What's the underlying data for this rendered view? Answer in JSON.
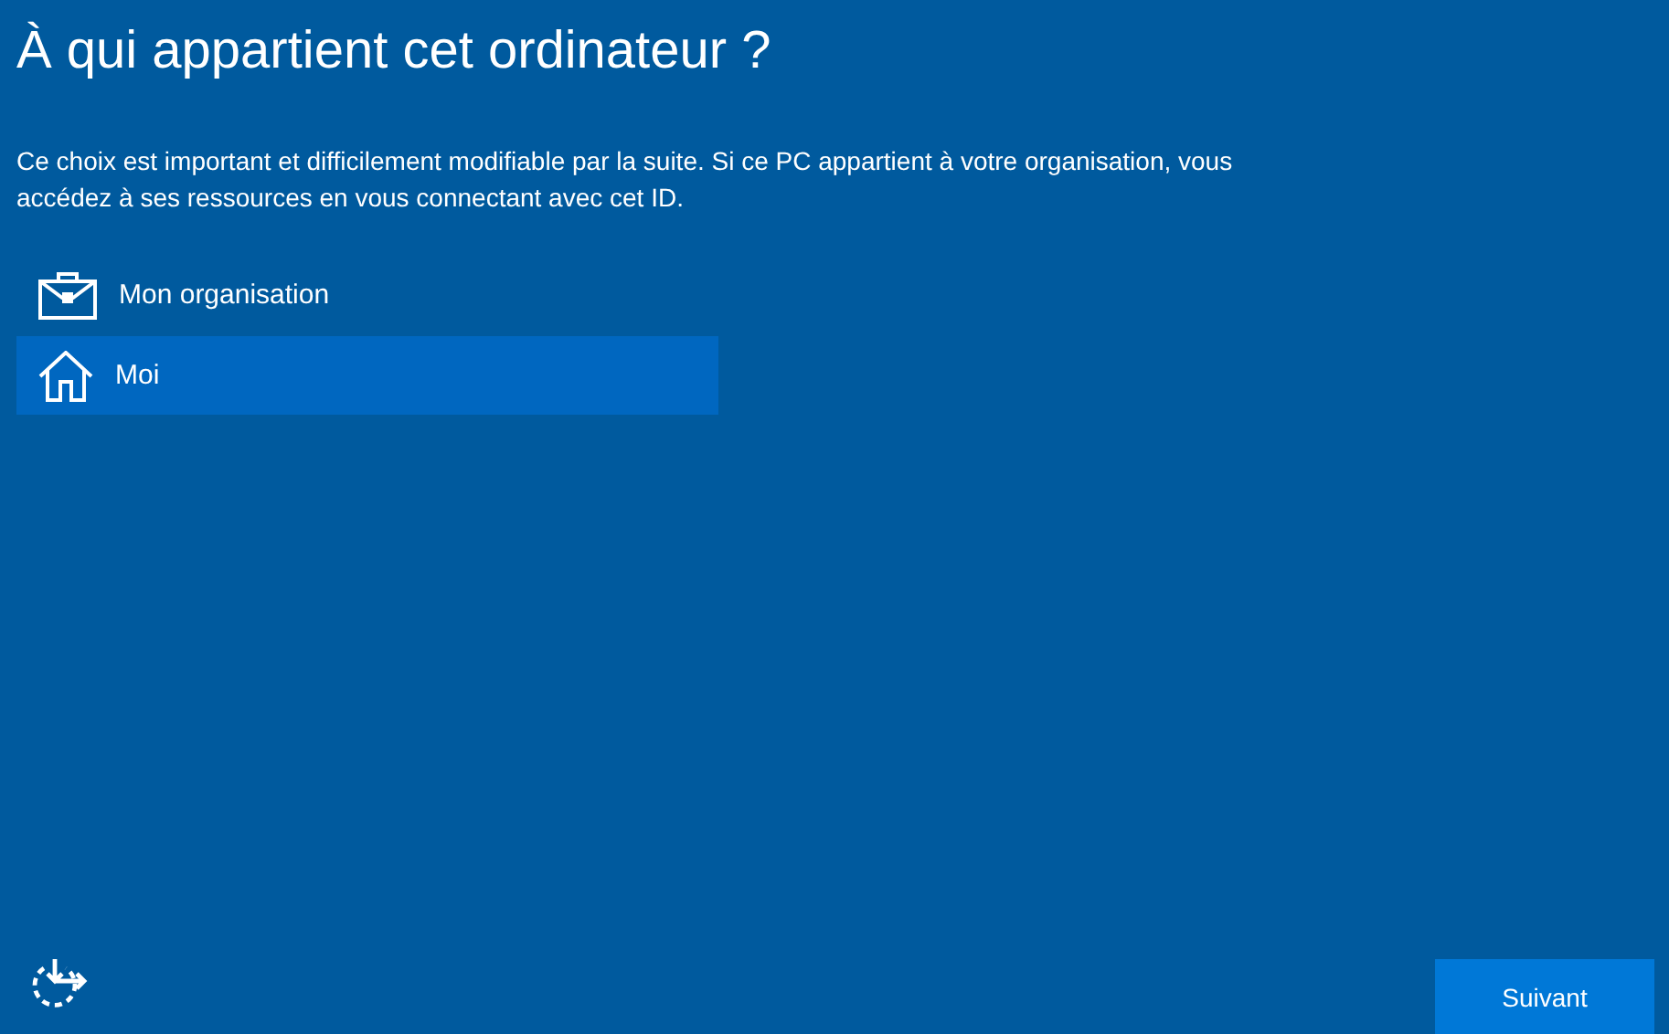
{
  "title": "À qui appartient cet ordinateur ?",
  "description": "Ce choix est important et difficilement modifiable par la suite. Si ce PC appartient à votre organisation, vous accédez à ses ressources en vous connectant avec cet ID.",
  "options": [
    {
      "kind": "work",
      "label": "Mon organisation",
      "selected": false
    },
    {
      "kind": "home",
      "label": "Moi",
      "selected": true
    }
  ],
  "next_button": "Suivant"
}
